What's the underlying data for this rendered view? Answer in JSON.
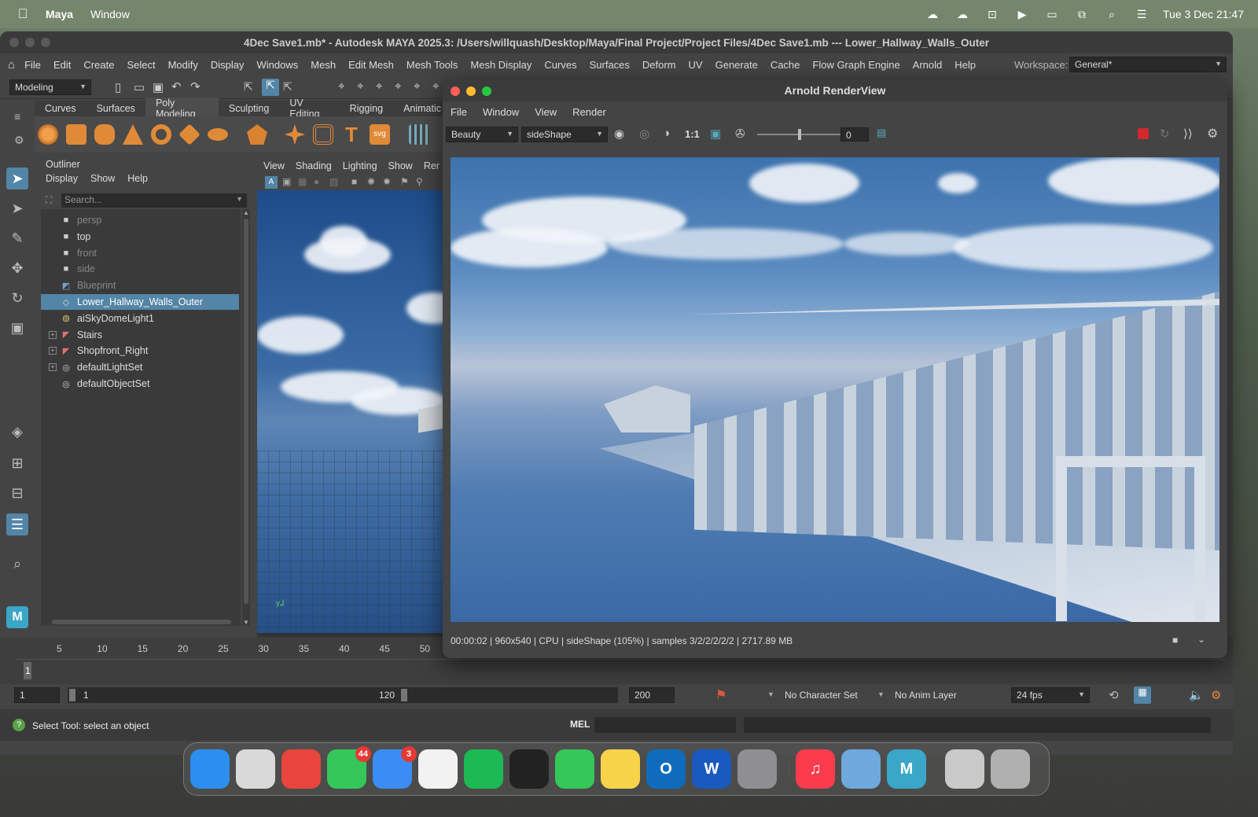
{
  "menubar": {
    "app_name": "Maya",
    "items": [
      "Window"
    ],
    "datetime": "Tue 3 Dec  21:47"
  },
  "maya": {
    "title": "4Dec Save1.mb* - Autodesk MAYA 2025.3: /Users/willquash/Desktop/Maya/Final Project/Project Files/4Dec Save1.mb  ---  Lower_Hallway_Walls_Outer",
    "menu": [
      "File",
      "Edit",
      "Create",
      "Select",
      "Modify",
      "Display",
      "Windows",
      "Mesh",
      "Edit Mesh",
      "Mesh Tools",
      "Mesh Display",
      "Curves",
      "Surfaces",
      "Deform",
      "UV",
      "Generate",
      "Cache",
      "Flow Graph Engine",
      "Arnold",
      "Help"
    ],
    "workspace_label": "Workspace:",
    "workspace_value": "General*",
    "mode_value": "Modeling",
    "shelf_tabs": [
      "Curves",
      "Surfaces",
      "Poly Modeling",
      "Sculpting",
      "UV Editing",
      "Rigging",
      "Animatic"
    ],
    "active_shelf_tab": "Poly Modeling"
  },
  "outliner": {
    "title": "Outliner",
    "menu": [
      "Display",
      "Show",
      "Help"
    ],
    "search_placeholder": "Search...",
    "items": [
      {
        "label": "persp",
        "icon": "camera-icon",
        "dim": true,
        "expandable": false,
        "selected": false
      },
      {
        "label": "top",
        "icon": "camera-icon",
        "dim": false,
        "expandable": false,
        "selected": false
      },
      {
        "label": "front",
        "icon": "camera-icon",
        "dim": true,
        "expandable": false,
        "selected": false
      },
      {
        "label": "side",
        "icon": "camera-icon",
        "dim": true,
        "expandable": false,
        "selected": false
      },
      {
        "label": "Blueprint",
        "icon": "image-plane-icon",
        "dim": true,
        "expandable": false,
        "selected": false
      },
      {
        "label": "Lower_Hallway_Walls_Outer",
        "icon": "mesh-icon",
        "dim": false,
        "expandable": false,
        "selected": true
      },
      {
        "label": "aiSkyDomeLight1",
        "icon": "skydome-icon",
        "dim": false,
        "expandable": false,
        "selected": false
      },
      {
        "label": "Stairs",
        "icon": "group-icon",
        "dim": false,
        "expandable": true,
        "selected": false
      },
      {
        "label": "Shopfront_Right",
        "icon": "group-icon",
        "dim": false,
        "expandable": true,
        "selected": false
      },
      {
        "label": "defaultLightSet",
        "icon": "set-icon",
        "dim": false,
        "expandable": true,
        "selected": false
      },
      {
        "label": "defaultObjectSet",
        "icon": "set-icon",
        "dim": false,
        "expandable": false,
        "selected": false
      }
    ]
  },
  "viewport": {
    "menu": [
      "View",
      "Shading",
      "Lighting",
      "Show",
      "Rer"
    ]
  },
  "timeline": {
    "ticks": [
      "5",
      "10",
      "15",
      "20",
      "25",
      "30",
      "35",
      "40",
      "45",
      "50"
    ],
    "current_frame": "1"
  },
  "range": {
    "start": "1",
    "inner_start": "1",
    "inner_end": "120",
    "end": "200",
    "character_set": "No Character Set",
    "anim_layer": "No Anim Layer",
    "fps": "24 fps"
  },
  "status": {
    "help_text": "Select Tool: select an object",
    "mel_label": "MEL"
  },
  "arnold": {
    "title": "Arnold RenderView",
    "menu": [
      "File",
      "Window",
      "View",
      "Render"
    ],
    "aov": "Beauty",
    "camera": "sideShape",
    "ratio": "1:1",
    "exposure": "0",
    "status_line": "00:00:02 | 960x540 | CPU | sideShape (105%) | samples 3/2/2/2/2/2 | 2717.89 MB"
  },
  "dock": {
    "apps": [
      {
        "name": "finder-icon",
        "label": "",
        "color": "#2c8ef0",
        "badge": ""
      },
      {
        "name": "launchpad-icon",
        "label": "",
        "color": "#d9d9d9",
        "badge": ""
      },
      {
        "name": "chrome-icon",
        "label": "",
        "color": "#e8453c",
        "badge": ""
      },
      {
        "name": "messages-icon",
        "label": "",
        "color": "#35c759",
        "badge": "44"
      },
      {
        "name": "mail-icon",
        "label": "",
        "color": "#3b8df5",
        "badge": "3"
      },
      {
        "name": "photos-icon",
        "label": "",
        "color": "#f2f2f2",
        "badge": ""
      },
      {
        "name": "spotify-icon",
        "label": "",
        "color": "#1db954",
        "badge": ""
      },
      {
        "name": "unity-icon",
        "label": "",
        "color": "#222222",
        "badge": ""
      },
      {
        "name": "facetime-icon",
        "label": "",
        "color": "#34c759",
        "badge": ""
      },
      {
        "name": "notes-icon",
        "label": "",
        "color": "#f7d34a",
        "badge": ""
      },
      {
        "name": "outlook-icon",
        "label": "O",
        "color": "#0f6cbd",
        "badge": ""
      },
      {
        "name": "word-icon",
        "label": "W",
        "color": "#185abd",
        "badge": ""
      },
      {
        "name": "system-settings-icon",
        "label": "",
        "color": "#8e8e93",
        "badge": ""
      },
      {
        "name": "music-icon",
        "label": "♫",
        "color": "#fa3c4c",
        "badge": ""
      },
      {
        "name": "preview-icon",
        "label": "",
        "color": "#6ea8dc",
        "badge": ""
      },
      {
        "name": "maya-icon",
        "label": "M",
        "color": "#3aa6c8",
        "badge": ""
      },
      {
        "name": "archive-icon",
        "label": "",
        "color": "#c9c9c9",
        "badge": ""
      },
      {
        "name": "trash-icon",
        "label": "",
        "color": "#b0b0b0",
        "badge": ""
      }
    ]
  }
}
